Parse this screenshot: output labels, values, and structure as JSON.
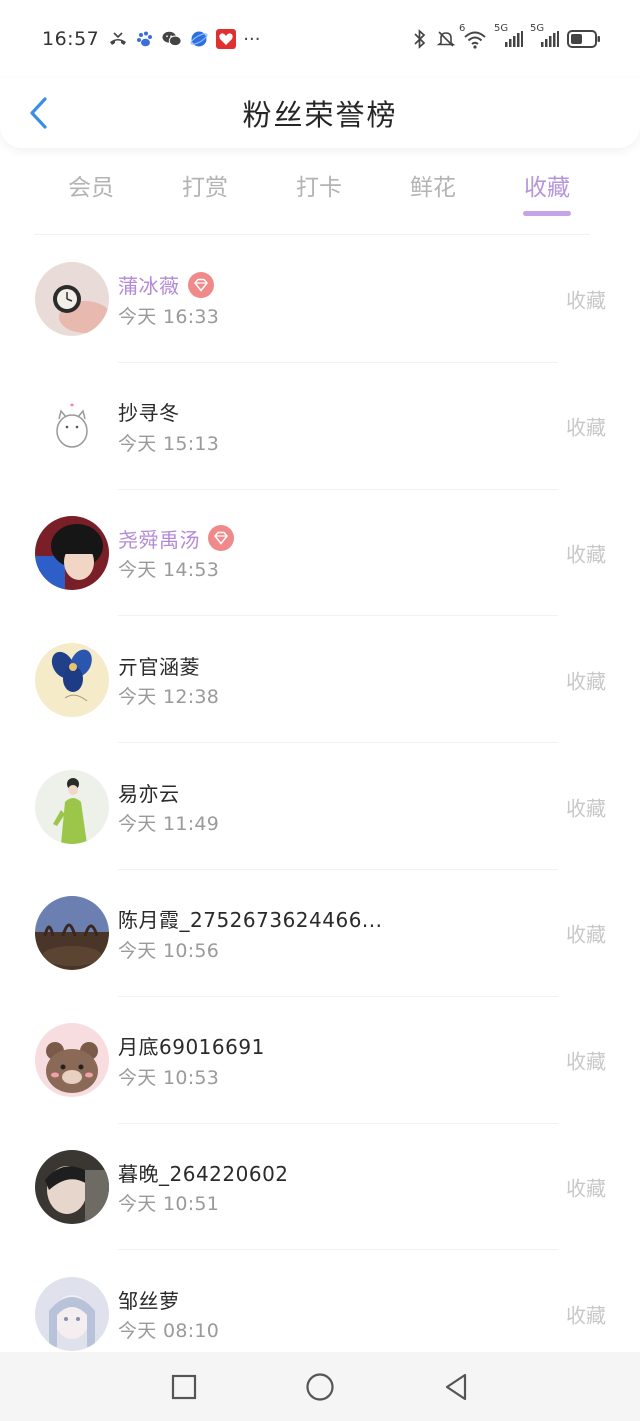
{
  "status_bar": {
    "time": "16:57",
    "more": "···",
    "network_label_1": "5G",
    "network_label_2": "5G",
    "wifi_label": "6"
  },
  "header": {
    "title": "粉丝荣誉榜"
  },
  "tabs": [
    {
      "label": "会员",
      "active": false
    },
    {
      "label": "打赏",
      "active": false
    },
    {
      "label": "打卡",
      "active": false
    },
    {
      "label": "鲜花",
      "active": false
    },
    {
      "label": "收藏",
      "active": true
    }
  ],
  "accent_color": "#b695db",
  "vip_badge_color": "#f08a8a",
  "list": [
    {
      "name": "蒲冰薇",
      "vip": true,
      "time": "今天 16:33",
      "action": "收藏"
    },
    {
      "name": "抄寻冬",
      "vip": false,
      "time": "今天 15:13",
      "action": "收藏"
    },
    {
      "name": "尧舜禹汤",
      "vip": true,
      "time": "今天 14:53",
      "action": "收藏"
    },
    {
      "name": "亓官涵菱",
      "vip": false,
      "time": "今天 12:38",
      "action": "收藏"
    },
    {
      "name": "易亦云",
      "vip": false,
      "time": "今天 11:49",
      "action": "收藏"
    },
    {
      "name": "陈月霞_2752673624466...",
      "vip": false,
      "time": "今天 10:56",
      "action": "收藏"
    },
    {
      "name": "月底69016691",
      "vip": false,
      "time": "今天 10:53",
      "action": "收藏"
    },
    {
      "name": "暮晚_264220602",
      "vip": false,
      "time": "今天 10:51",
      "action": "收藏"
    },
    {
      "name": "邹丝萝",
      "vip": false,
      "time": "今天 08:10",
      "action": "收藏"
    }
  ],
  "nav": {
    "icons": [
      "recents-square-icon",
      "home-circle-icon",
      "back-triangle-icon"
    ]
  }
}
